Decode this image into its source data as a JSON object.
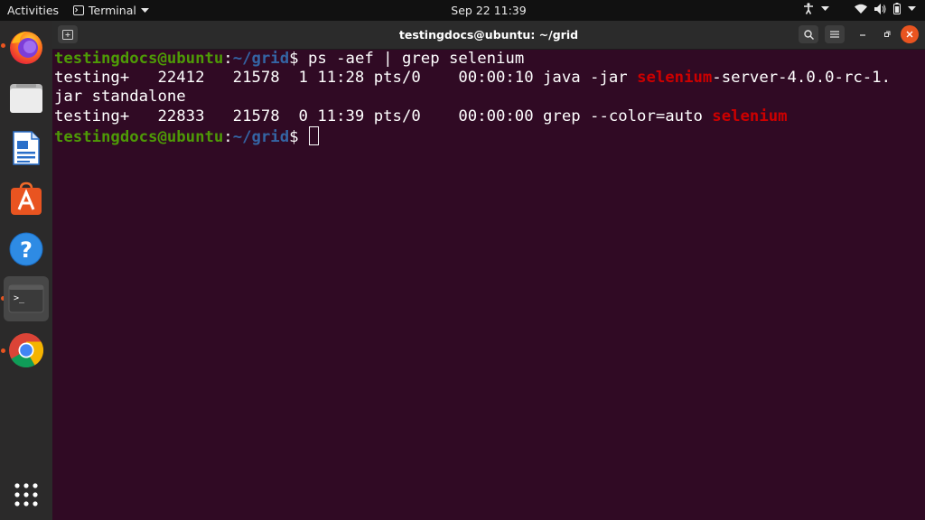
{
  "topbar": {
    "activities": "Activities",
    "app_name": "Terminal",
    "clock": "Sep 22  11:39"
  },
  "dock": {
    "apps": [
      "firefox",
      "files",
      "libreoffice-writer",
      "ubuntu-software",
      "help",
      "terminal",
      "chrome",
      "show-applications"
    ]
  },
  "window": {
    "title": "testingdocs@ubuntu: ~/grid"
  },
  "terminal": {
    "prompt_user": "testingdocs@ubuntu",
    "prompt_sep": ":",
    "prompt_path": "~/grid",
    "prompt_dollar": "$ ",
    "command": "ps -aef | grep selenium",
    "row1_a": "testing+   22412   21578  1 11:28 pts/0    00:00:10 java -jar ",
    "row1_hl": "selenium",
    "row1_b": "-server-4.0.0-rc-1.",
    "row1_wrap": "jar standalone",
    "row2_a": "testing+   22833   21578  0 11:39 pts/0    00:00:00 grep --color=auto ",
    "row2_hl": "selenium"
  },
  "colors": {
    "terminal_bg": "#300a24",
    "prompt_user": "#4e9a06",
    "prompt_path": "#3465a4",
    "highlight": "#cc0000",
    "accent": "#e95420"
  }
}
